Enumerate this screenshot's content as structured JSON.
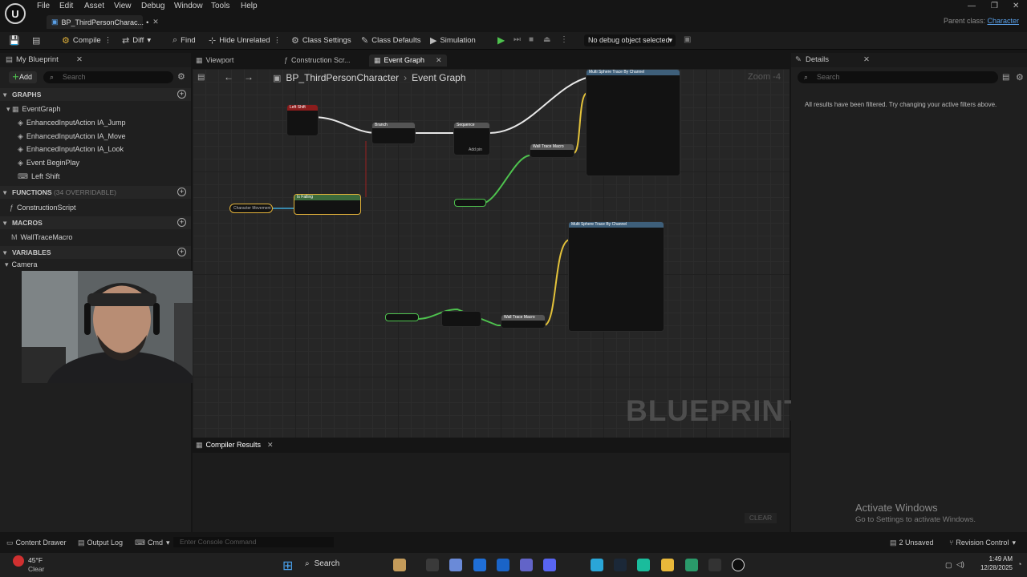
{
  "menubar": {
    "items": [
      "File",
      "Edit",
      "Asset",
      "View",
      "Debug",
      "Window",
      "Tools",
      "Help"
    ]
  },
  "title_tab": {
    "label": "BP_ThirdPersonCharac...",
    "modified": "•"
  },
  "parent_class": {
    "label": "Parent class:",
    "value": "Character"
  },
  "toolbar": {
    "compile": "Compile",
    "diff": "Diff",
    "find": "Find",
    "hide_unrelated": "Hide Unrelated",
    "class_settings": "Class Settings",
    "class_defaults": "Class Defaults",
    "simulation": "Simulation",
    "debug_object": "No debug object selected"
  },
  "my_blueprint": {
    "title": "My Blueprint",
    "add_label": "Add",
    "search_placeholder": "Search",
    "sections": {
      "graphs": "GRAPHS",
      "functions": "FUNCTIONS",
      "functions_sub": "(34 OVERRIDABLE)",
      "macros": "MACROS",
      "variables": "VARIABLES"
    },
    "graphs_items": [
      "EventGraph",
      "EnhancedInputAction IA_Jump",
      "EnhancedInputAction IA_Move",
      "EnhancedInputAction IA_Look",
      "Event BeginPlay",
      "Left Shift"
    ],
    "functions_items": [
      "ConstructionScript"
    ],
    "macros_items": [
      "WallTraceMacro"
    ],
    "variables_items": [
      "Camera"
    ]
  },
  "editor_tabs": {
    "viewport": "Viewport",
    "construction": "Construction Scr...",
    "event_graph": "Event Graph"
  },
  "breadcrumb": {
    "blueprint": "BP_ThirdPersonCharacter",
    "graph": "Event Graph"
  },
  "zoom": "Zoom -4",
  "watermark": "BLUEPRINT",
  "nodes": {
    "left_shift": "Left Shift",
    "branch": "Branch",
    "sequence": "Sequence",
    "multi_sphere_1": "Multi Sphere Trace By Channel",
    "multi_sphere_2": "Multi Sphere Trace By Channel",
    "wall_trace_1": "Wall Trace Macro",
    "wall_trace_2": "Wall Trace Macro",
    "falling": "Is Falling",
    "char_movement": "Character Movement",
    "add_pin": "Add pin"
  },
  "compiler_results": {
    "tab": "Compiler Results",
    "clear": "CLEAR"
  },
  "details": {
    "title": "Details",
    "search_placeholder": "Search",
    "message": "All results have been filtered. Try changing your active filters above."
  },
  "activate_windows": {
    "title": "Activate Windows",
    "subtitle": "Go to Settings to activate Windows."
  },
  "statusbar": {
    "content_drawer": "Content Drawer",
    "output_log": "Output Log",
    "cmd": "Cmd",
    "console_placeholder": "Enter Console Command",
    "unsaved": "2 Unsaved",
    "revision_control": "Revision Control"
  },
  "taskbar": {
    "weather_temp": "45°F",
    "weather_desc": "Clear",
    "search_label": "Search",
    "time": "1:49 AM",
    "date": "12/28/2025"
  }
}
